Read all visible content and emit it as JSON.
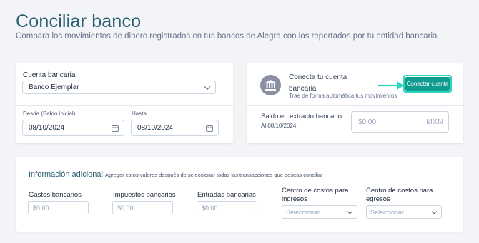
{
  "page": {
    "title": "Conciliar banco",
    "subtitle": "Compara los movimientos de dinero registrados en tus bancos de Alegra con los reportados por tu entidad bancaria"
  },
  "bank_card": {
    "account_label": "Cuenta bancaria",
    "account_value": "Banco Ejemplar",
    "start_label": "Desde (Saldo inicial)",
    "start_value": "08/10/2024",
    "end_label": "Hasta",
    "end_value": "08/10/2024"
  },
  "connect_card": {
    "title": "Conecta tu cuenta bancaria",
    "description": "Trae de forma automática tus movimientos",
    "button_label": "Conectar cuenta",
    "statement_label": "Saldo en extracto bancario",
    "statement_date": "Al 08/10/2024",
    "statement_placeholder": "$0.00",
    "currency": "MXN"
  },
  "additional": {
    "title": "Información adicional",
    "subtitle": "Agregar estos valores después de seleccionar todas las transacciones que deseas conciliar",
    "fields": [
      {
        "label": "Gastos bancarios",
        "placeholder": "$0.00"
      },
      {
        "label": "Impuestos bancarios",
        "placeholder": "$0.00"
      },
      {
        "label": "Entradas bancarias",
        "placeholder": "$0.00"
      }
    ],
    "dropdowns": [
      {
        "label": "Centro de costos para ingresos",
        "placeholder": "Seleccionar"
      },
      {
        "label": "Centro de costos para egresos",
        "placeholder": "Seleccionar"
      }
    ]
  },
  "colors": {
    "title": "#2b5f72",
    "button": "#0f9b8e",
    "highlight": "#2dd4bf"
  },
  "icons": {
    "bank": "bank-icon",
    "calendar": "calendar-icon",
    "chevron": "chevron-down-icon",
    "arrow": "arrow-right-icon"
  }
}
